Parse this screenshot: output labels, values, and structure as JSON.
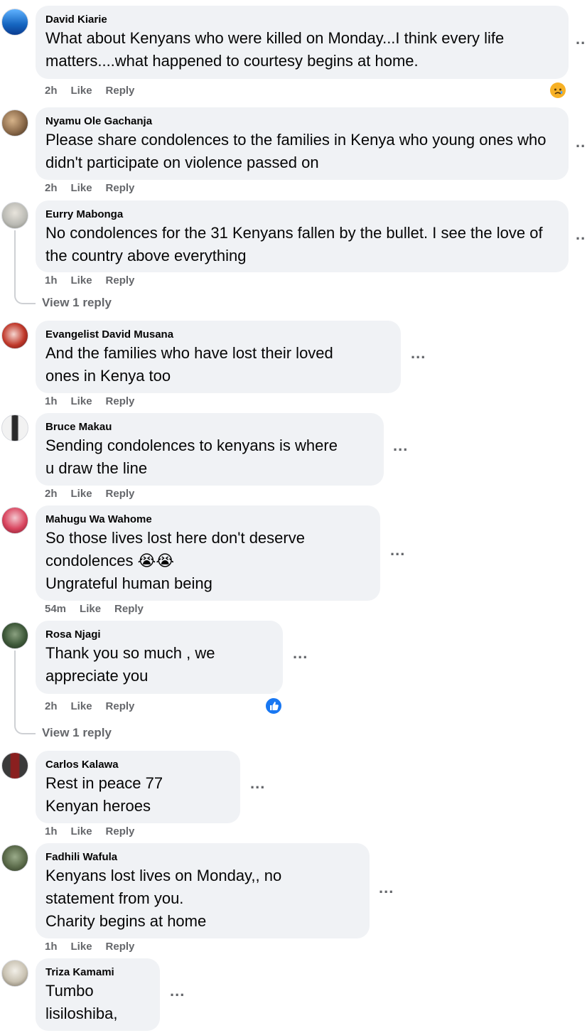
{
  "comments": [
    {
      "author": "David Kiarie",
      "text": "What about Kenyans who were killed on Monday...I think every life matters....what happened to courtesy begins at home.",
      "time": "2h",
      "like": "Like",
      "reply": "Reply",
      "avatar_color": "#1a6fd6",
      "reaction": "sad-emoji"
    },
    {
      "author": "Nyamu Ole Gachanja",
      "text": "Please share condolences to the families in Kenya who young ones who didn't participate on violence passed on",
      "time": "2h",
      "like": "Like",
      "reply": "Reply",
      "avatar_color": "#8b6a4a"
    },
    {
      "author": "Eurry Mabonga",
      "text": "No condolences for the 31 Kenyans fallen by the bullet. I see the love of the country above everything",
      "time": "1h",
      "like": "Like",
      "reply": "Reply",
      "avatar_color": "#b9b9b3",
      "view_replies": "View 1 reply"
    },
    {
      "author": "Evangelist David Musana",
      "text": "And the families who have lost their loved\nones in Kenya too",
      "time": "1h",
      "like": "Like",
      "reply": "Reply",
      "avatar_color": "#c0392b"
    },
    {
      "author": "Bruce Makau",
      "text": "Sending condolences to kenyans is where\nu draw the line",
      "time": "2h",
      "like": "Like",
      "reply": "Reply",
      "avatar_color": "#2b2b2b"
    },
    {
      "author": "Mahugu Wa Wahome",
      "text": "So those lives lost here don't deserve\ncondolences 😭😭\nUngrateful human being",
      "time": "54m",
      "like": "Like",
      "reply": "Reply",
      "avatar_color": "#d9455f"
    },
    {
      "author": "Rosa Njagi",
      "text": "Thank you so much , we\nappreciate you",
      "time": "2h",
      "like": "Like",
      "reply": "Reply",
      "avatar_color": "#3f5a3a",
      "reaction": "like-thumb-icon",
      "view_replies": "View 1 reply"
    },
    {
      "author": "Carlos Kalawa",
      "text": "Rest in peace 77\nKenyan heroes",
      "time": "1h",
      "like": "Like",
      "reply": "Reply",
      "avatar_color": "#8a1f1f"
    },
    {
      "author": "Fadhili Wafula",
      "text": "Kenyans lost lives on Monday,, no\nstatement from you.\nCharity begins at home",
      "time": "1h",
      "like": "Like",
      "reply": "Reply",
      "avatar_color": "#5b6b4a"
    },
    {
      "author": "Triza Kamami",
      "text": "Tumbo\nlisiloshiba,",
      "time": "",
      "like": "",
      "reply": "",
      "avatar_color": "#c9c2b2"
    }
  ],
  "more_dots": "...",
  "more_dots_clipped": ".."
}
